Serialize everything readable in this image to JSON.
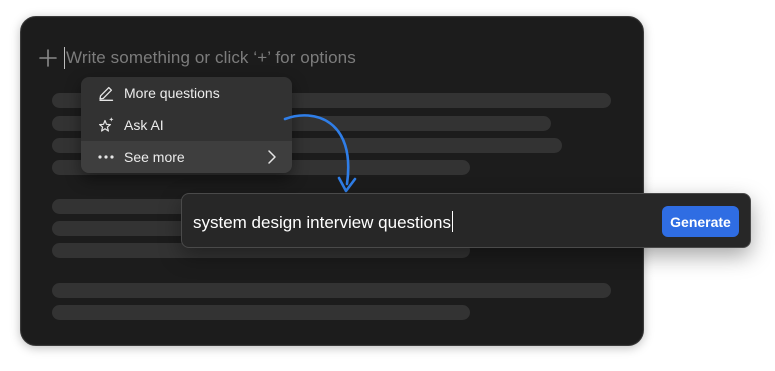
{
  "editor": {
    "placeholder": "Write something or click ‘+’ for options",
    "add_icon": "plus-icon"
  },
  "menu": {
    "items": [
      {
        "label": "More questions",
        "icon": "pencil-icon"
      },
      {
        "label": "Ask AI",
        "icon": "sparkle-star-icon"
      },
      {
        "label": "See more",
        "icon": "ellipsis-icon",
        "has_submenu": true
      }
    ]
  },
  "prompt": {
    "value": "system design interview questions",
    "button_label": "Generate"
  },
  "colors": {
    "card_background": "#1c1c1c",
    "menu_background": "#323232",
    "accent_blue": "#2f6de3",
    "arrow_blue": "#2f7ee8"
  }
}
